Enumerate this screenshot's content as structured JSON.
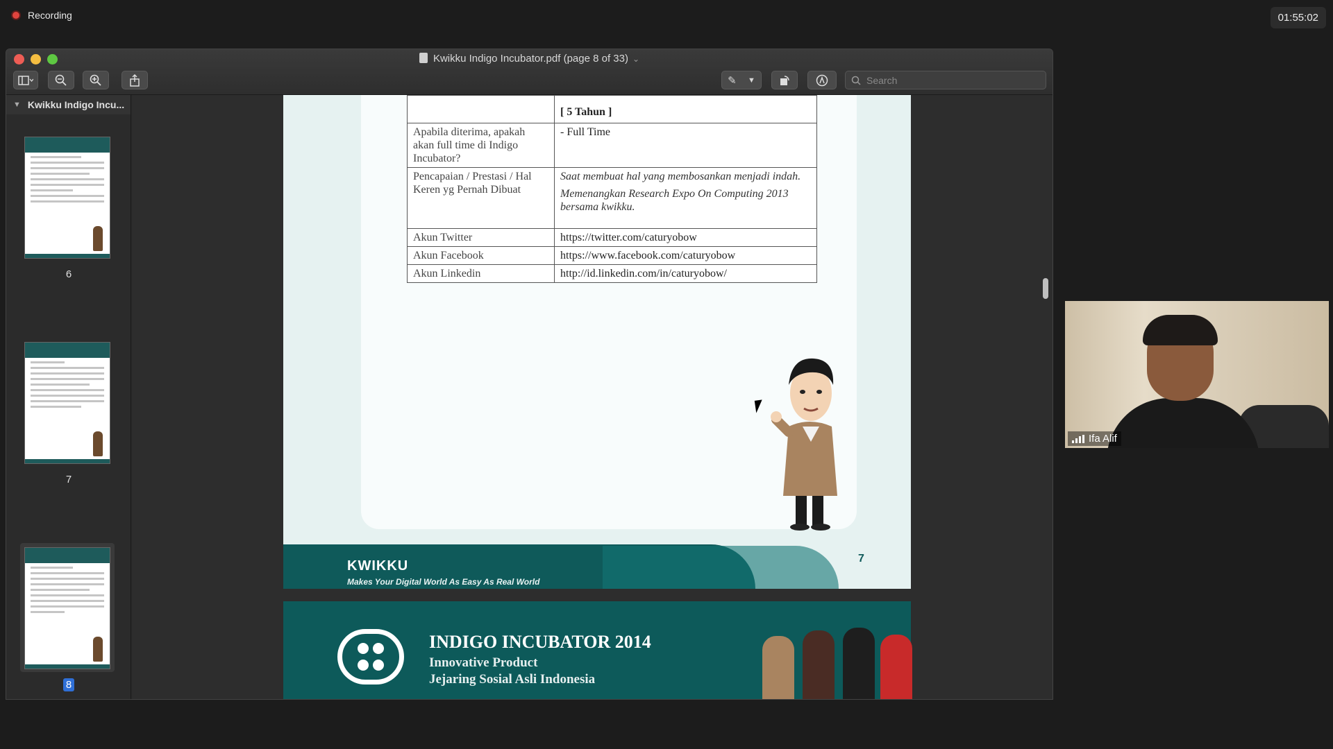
{
  "meeting": {
    "recording_label": "Recording",
    "timer": "01:55:02",
    "participant_name": "Ifa Alif"
  },
  "window": {
    "title": "Kwikku Indigo Incubator.pdf (page 8 of 33)",
    "search_placeholder": "Search"
  },
  "sidebar": {
    "doc_name": "Kwikku Indigo Incu...",
    "pages": [
      {
        "label": "6"
      },
      {
        "label": "7"
      },
      {
        "label": "8",
        "selected": true
      }
    ]
  },
  "document": {
    "top_partial": "[ 5 Tahun ]",
    "rows": [
      {
        "label": "Apabila diterima, apakah akan full time di Indigo Incubator?",
        "value": "- Full Time"
      },
      {
        "label": "Pencapaian / Prestasi / Hal Keren yg Pernah Dibuat",
        "value_1": "Saat membuat hal yang membosankan menjadi indah.",
        "value_2": "Memenangkan Research Expo On Computing 2013 bersama kwikku."
      },
      {
        "label": "Akun Twitter",
        "value": "https://twitter.com/caturyobow"
      },
      {
        "label": "Akun Facebook",
        "value": "https://www.facebook.com/caturyobow"
      },
      {
        "label": "Akun Linkedin",
        "value": "http://id.linkedin.com/in/caturyobow/"
      }
    ],
    "footer_brand": "KWIKKU",
    "footer_tagline": "Makes Your Digital World As Easy As Real World",
    "page_number": "7",
    "next_page_title": "INDIGO INCUBATOR 2014",
    "next_page_sub1": "Innovative Product",
    "next_page_sub2": "Jejaring Sosial Asli Indonesia"
  }
}
